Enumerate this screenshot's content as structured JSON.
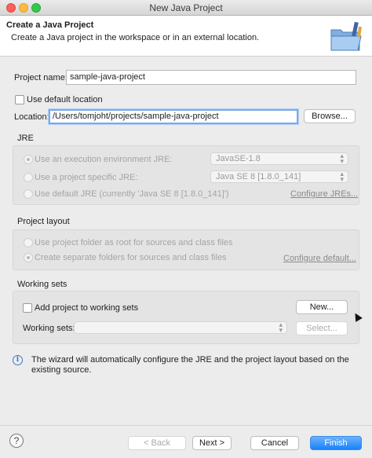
{
  "window": {
    "title": "New Java Project"
  },
  "header": {
    "title": "Create a Java Project",
    "description": "Create a Java project in the workspace or in an external location."
  },
  "project": {
    "name_label": "Project name:",
    "name_value": "sample-java-project"
  },
  "location": {
    "use_default_label": "Use default location",
    "label": "Location:",
    "value": "/Users/tomjoht/projects/sample-java-project",
    "browse_label": "Browse..."
  },
  "jre": {
    "group_label": "JRE",
    "option_env": "Use an execution environment JRE:",
    "option_specific": "Use a project specific JRE:",
    "option_default": "Use default JRE (currently 'Java SE 8 [1.8.0_141]')",
    "env_select": "JavaSE-1.8",
    "specific_select": "Java SE 8 [1.8.0_141]",
    "configure_link": "Configure JREs..."
  },
  "layout": {
    "group_label": "Project layout",
    "option_root": "Use project folder as root for sources and class files",
    "option_separate": "Create separate folders for sources and class files",
    "configure_link": "Configure default..."
  },
  "working_sets": {
    "group_label": "Working sets",
    "add_label": "Add project to working sets",
    "new_button": "New...",
    "sets_label": "Working sets:",
    "select_button": "Select..."
  },
  "info": {
    "text": "The wizard will automatically configure the JRE and the project layout based on the existing source."
  },
  "footer": {
    "help": "?",
    "back": "< Back",
    "next": "Next >",
    "cancel": "Cancel",
    "finish": "Finish"
  }
}
